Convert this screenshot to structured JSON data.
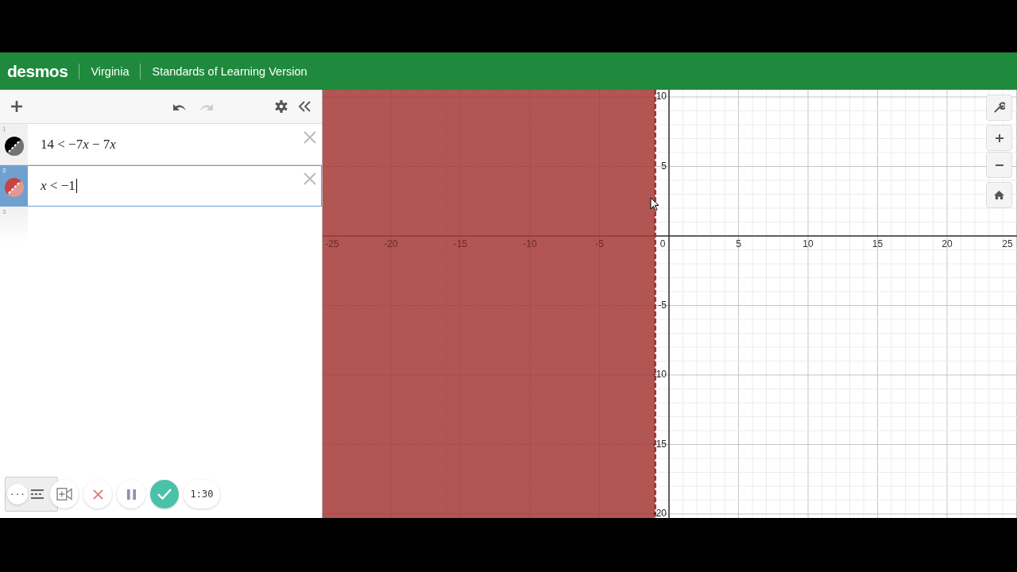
{
  "header": {
    "logo": "desmos",
    "items": [
      "Virginia",
      "Standards of Learning Version"
    ]
  },
  "expressions": [
    {
      "number": "1",
      "latex": [
        {
          "text": "14 < −7"
        },
        {
          "text": "x",
          "kind": "var"
        },
        {
          "text": " − 7"
        },
        {
          "text": "x",
          "kind": "var"
        }
      ],
      "color": "#000000",
      "selected": false
    },
    {
      "number": "2",
      "latex": [
        {
          "text": "x",
          "kind": "var"
        },
        {
          "text": " < −1"
        }
      ],
      "color": "#c74440",
      "selected": true
    },
    {
      "number": "3",
      "selected": false
    }
  ],
  "graph": {
    "x_labels": [
      "-25",
      "-20",
      "-15",
      "-10",
      "-5",
      "0",
      "5",
      "10",
      "15",
      "20",
      "25"
    ],
    "y_labels": [
      "10",
      "5",
      "-5",
      "-10",
      "-15",
      "-20"
    ]
  },
  "recorder": {
    "more": "···",
    "timer": "1:30"
  }
}
